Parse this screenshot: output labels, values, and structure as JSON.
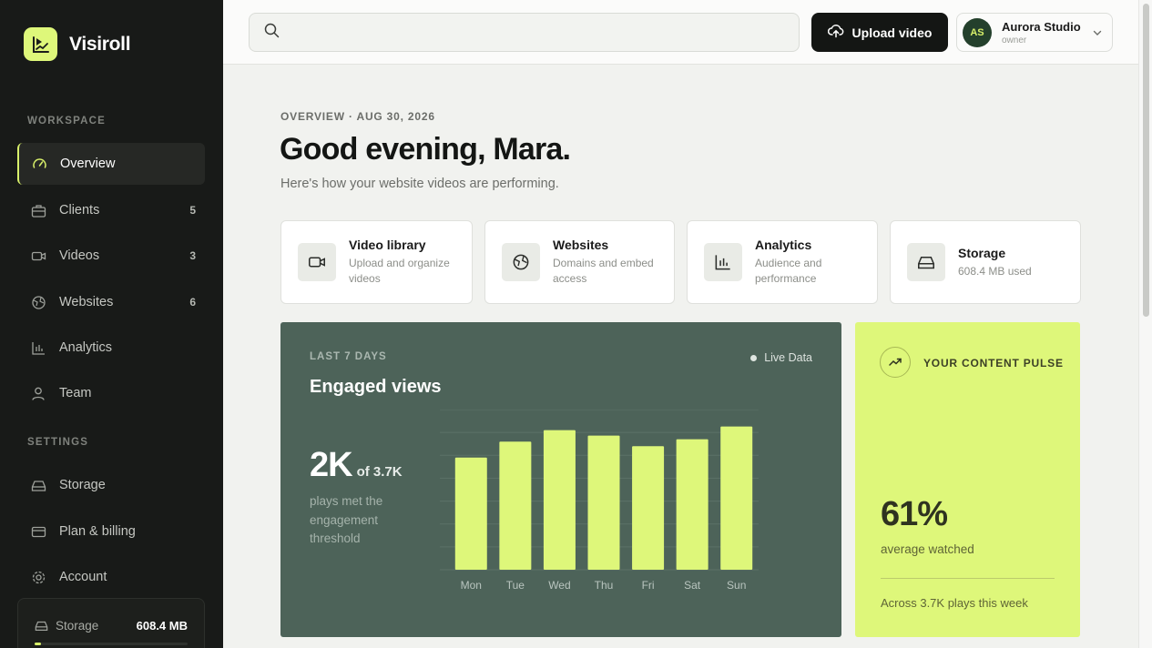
{
  "app": {
    "name": "Visiroll"
  },
  "sidebar": {
    "workspace_label": "WORKSPACE",
    "settings_label": "SETTINGS",
    "workspace_items": [
      {
        "label": "Overview",
        "icon": "gauge-icon",
        "count": ""
      },
      {
        "label": "Clients",
        "icon": "briefcase-icon",
        "count": "5"
      },
      {
        "label": "Videos",
        "icon": "video-icon",
        "count": "3"
      },
      {
        "label": "Websites",
        "icon": "globe-icon",
        "count": "6"
      },
      {
        "label": "Analytics",
        "icon": "bar-chart-icon",
        "count": ""
      },
      {
        "label": "Team",
        "icon": "user-icon",
        "count": ""
      }
    ],
    "settings_items": [
      {
        "label": "Storage",
        "icon": "drive-icon"
      },
      {
        "label": "Plan & billing",
        "icon": "card-icon"
      },
      {
        "label": "Account",
        "icon": "gear-icon"
      }
    ],
    "storage": {
      "label": "Storage",
      "value": "608.4 MB",
      "fill_fraction": 0.04
    }
  },
  "topbar": {
    "search_placeholder": "",
    "upload_label": "Upload video",
    "account": {
      "initials": "AS",
      "name": "Aurora Studio",
      "role": "owner"
    }
  },
  "main": {
    "eyebrow": "OVERVIEW · AUG 30, 2026",
    "headline": "Good evening, Mara.",
    "subline": "Here's how your website videos are performing.",
    "cards": [
      {
        "title": "Video library",
        "desc": "Upload and organize videos",
        "icon": "video-icon"
      },
      {
        "title": "Websites",
        "desc": "Domains and embed access",
        "icon": "globe-icon"
      },
      {
        "title": "Analytics",
        "desc": "Audience and performance",
        "icon": "bar-chart-icon"
      },
      {
        "title": "Storage",
        "desc": "608.4 MB used",
        "icon": "drive-icon"
      }
    ],
    "views_panel": {
      "eyebrow": "LAST 7 DAYS",
      "live_label": "Live Data",
      "title": "Engaged views",
      "big_value": "2K",
      "of_value": "of 3.7K",
      "note": "plays met the engagement threshold"
    },
    "pulse": {
      "label": "YOUR CONTENT PULSE",
      "big_value": "61%",
      "sub": "average watched",
      "footer": "Across 3.7K plays this week"
    }
  },
  "colors": {
    "accent": "#def77a",
    "sidebar_bg": "#181a18",
    "panel_bg": "#4d6359"
  },
  "chart_data": {
    "type": "bar",
    "categories": [
      "Mon",
      "Tue",
      "Wed",
      "Thu",
      "Fri",
      "Sat",
      "Sun"
    ],
    "values": [
      245,
      280,
      305,
      293,
      270,
      285,
      313
    ],
    "title": "Engaged views",
    "xlabel": "",
    "ylabel": "",
    "ylim": [
      0,
      350
    ],
    "grid": true
  }
}
